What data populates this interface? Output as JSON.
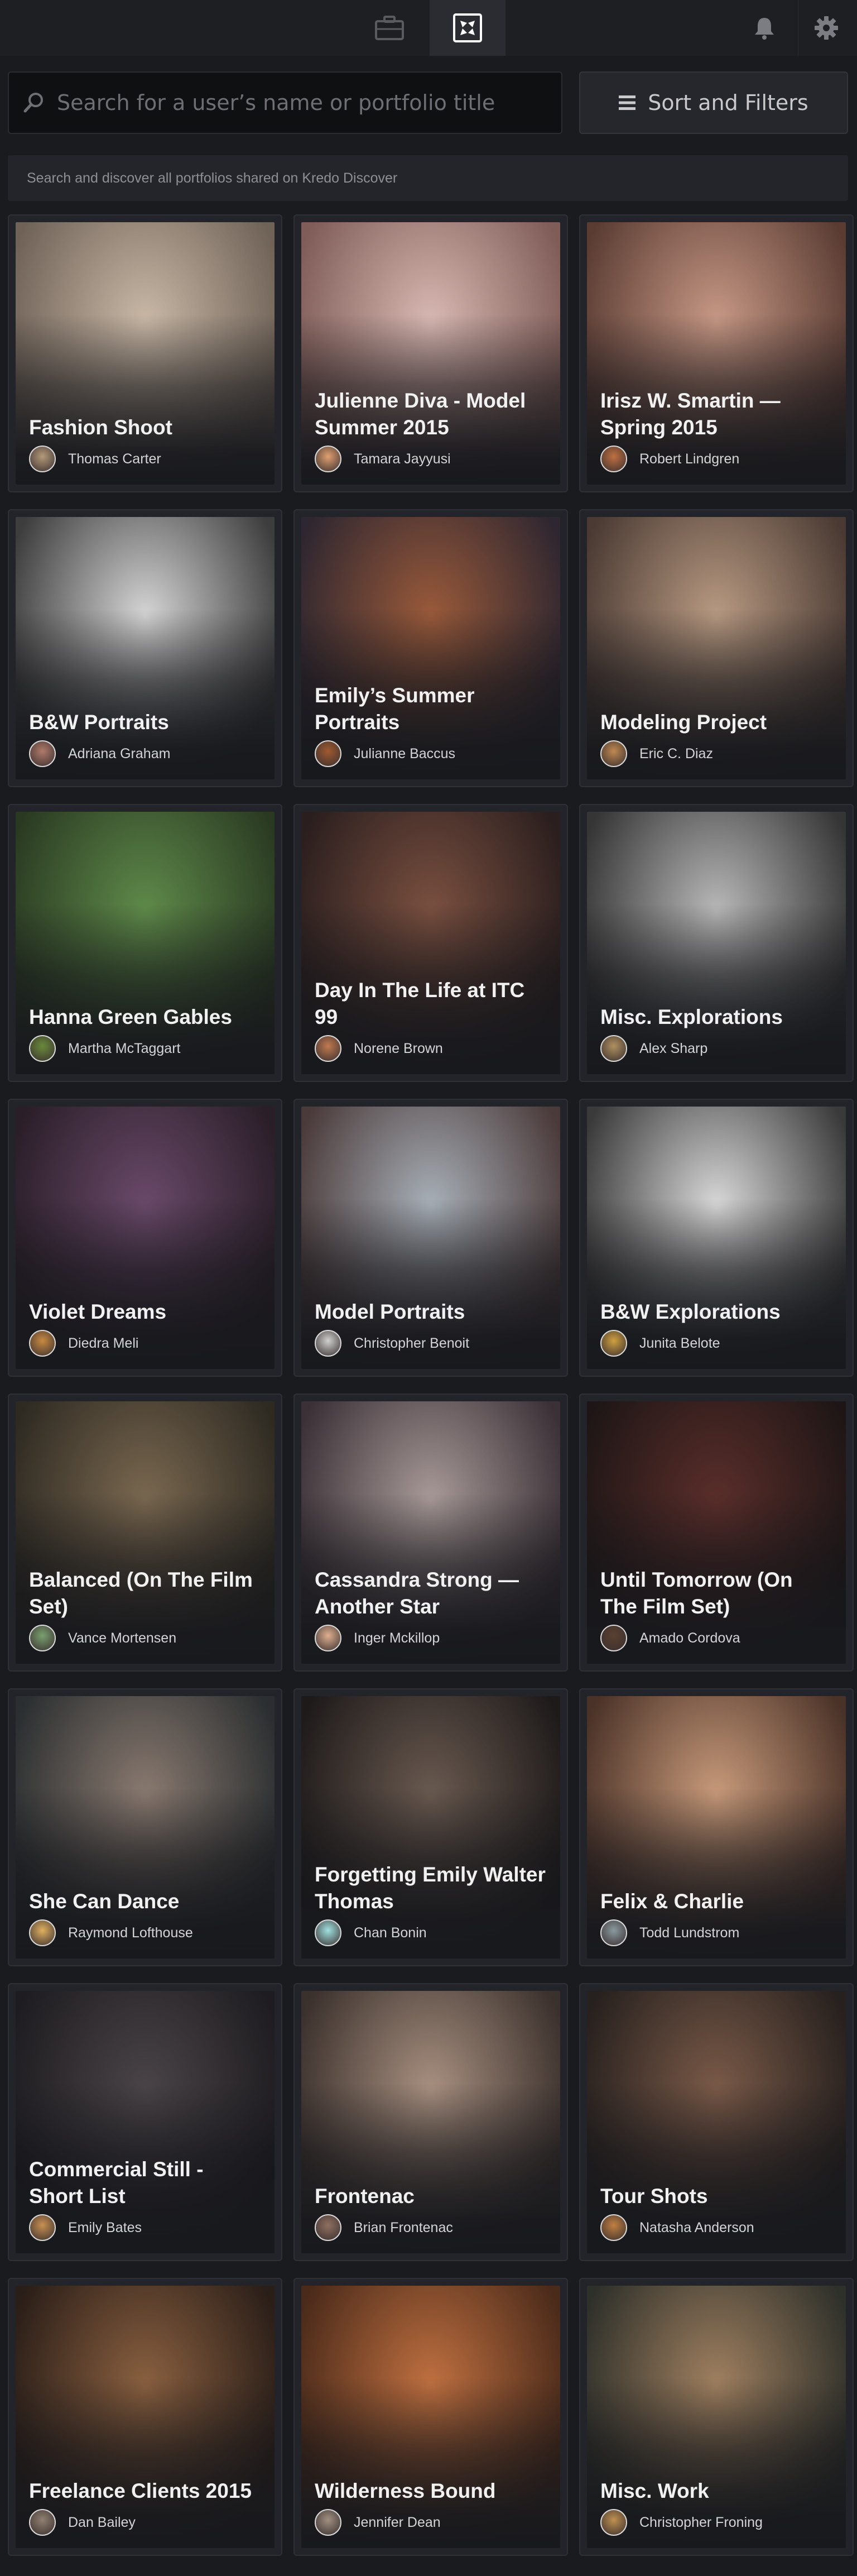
{
  "topbar": {
    "tabs": [
      {
        "icon": "briefcase-icon",
        "active": false
      },
      {
        "icon": "discover-icon",
        "active": true
      }
    ],
    "actions": [
      {
        "icon": "bell-icon"
      },
      {
        "icon": "gear-icon"
      }
    ]
  },
  "search": {
    "placeholder": "Search for a user’s name or portfolio title",
    "icon": "search-icon"
  },
  "sort_button": {
    "label": "Sort and Filters",
    "icon": "hamburger-icon"
  },
  "subtitle": "Search and discover all portfolios shared on Kredo Discover",
  "portfolios": [
    {
      "title": "Fashion Shoot",
      "author": "Thomas Carter",
      "colors": [
        "#c9b8a6",
        "#6f6257"
      ],
      "avatar": "#b59a7a"
    },
    {
      "title": "Julienne Diva - Model Summer 2015",
      "author": "Tamara Jayyusi",
      "colors": [
        "#d8b8b2",
        "#7f5c57"
      ],
      "avatar": "#e0a070"
    },
    {
      "title": "Irisz W. Smartin — Spring 2015",
      "author": "Robert Lindgren",
      "colors": [
        "#c79885",
        "#5a3c33"
      ],
      "avatar": "#c07040"
    },
    {
      "title": "B&W Portraits",
      "author": "Adriana Graham",
      "colors": [
        "#d5d5d5",
        "#3d3d3d"
      ],
      "avatar": "#b07a6a"
    },
    {
      "title": "Emily’s Summer Portraits",
      "author": "Julianne Baccus",
      "colors": [
        "#9a5a3a",
        "#2e2630"
      ],
      "avatar": "#a05a30"
    },
    {
      "title": "Modeling Project",
      "author": "Eric C. Diaz",
      "colors": [
        "#b89a82",
        "#4a3a33"
      ],
      "avatar": "#c08850"
    },
    {
      "title": "Hanna Green Gables",
      "author": "Martha McTaggart",
      "colors": [
        "#5f8a4a",
        "#2a3a22"
      ],
      "avatar": "#6a8a3a"
    },
    {
      "title": "Day In The Life at ITC 99",
      "author": "Norene Brown",
      "colors": [
        "#7a5040",
        "#2a1e1e"
      ],
      "avatar": "#c07a50"
    },
    {
      "title": "Misc. Explorations",
      "author": "Alex Sharp",
      "colors": [
        "#b8b8b8",
        "#353535"
      ],
      "avatar": "#b09060"
    },
    {
      "title": "Violet Dreams",
      "author": "Diedra Meli",
      "colors": [
        "#6a4a6a",
        "#2a1e28"
      ],
      "avatar": "#c88a40"
    },
    {
      "title": "Model Portraits",
      "author": "Christopher Benoit",
      "colors": [
        "#a8b0b8",
        "#4a3a3a"
      ],
      "avatar": "#d0d0d0"
    },
    {
      "title": "B&W Explorations",
      "author": "Junita Belote",
      "colors": [
        "#d8d8d8",
        "#3a3a3a"
      ],
      "avatar": "#d0a040"
    },
    {
      "title": "Balanced (On The Film Set)",
      "author": "Vance Mortensen",
      "colors": [
        "#7a6850",
        "#2e2a22"
      ],
      "avatar": "#7aa070"
    },
    {
      "title": "Cassandra Strong — Another Star",
      "author": "Inger Mckillop",
      "colors": [
        "#a89a98",
        "#3a3036"
      ],
      "avatar": "#e0b090"
    },
    {
      "title": "Until Tomorrow (On The Film Set)",
      "author": "Amado Cordova",
      "colors": [
        "#5a2e2a",
        "#1e1616"
      ],
      "avatar": "#5a4030"
    },
    {
      "title": "She Can Dance",
      "author": "Raymond Lofthouse",
      "colors": [
        "#8a7a70",
        "#2a2e30"
      ],
      "avatar": "#e0b060"
    },
    {
      "title": "Forgetting Emily Walter Thomas",
      "author": "Chan Bonin",
      "colors": [
        "#6a5a50",
        "#1e1a1a"
      ],
      "avatar": "#a0e0e0"
    },
    {
      "title": "Felix & Charlie",
      "author": "Todd Lundstrom",
      "colors": [
        "#c89a7a",
        "#4a3228"
      ],
      "avatar": "#8a9aa0"
    },
    {
      "title": "Commercial Still - Short List",
      "author": "Emily Bates",
      "colors": [
        "#4a4448",
        "#1e1c20"
      ],
      "avatar": "#c89050"
    },
    {
      "title": "Frontenac",
      "author": "Brian Frontenac",
      "colors": [
        "#a89080",
        "#3a302c"
      ],
      "avatar": "#907060"
    },
    {
      "title": "Tour Shots",
      "author": "Natasha Anderson",
      "colors": [
        "#7a5a48",
        "#26201e"
      ],
      "avatar": "#c08040"
    },
    {
      "title": "Freelance Clients 2015",
      "author": "Dan Bailey",
      "colors": [
        "#8a6040",
        "#2a1e18"
      ],
      "avatar": "#908070"
    },
    {
      "title": "Wilderness Bound",
      "author": "Jennifer Dean",
      "colors": [
        "#c07040",
        "#4a2a1a"
      ],
      "avatar": "#a09080"
    },
    {
      "title": "Misc. Work",
      "author": "Christopher Froning",
      "colors": [
        "#a08060",
        "#2e302a"
      ],
      "avatar": "#c09050"
    }
  ]
}
